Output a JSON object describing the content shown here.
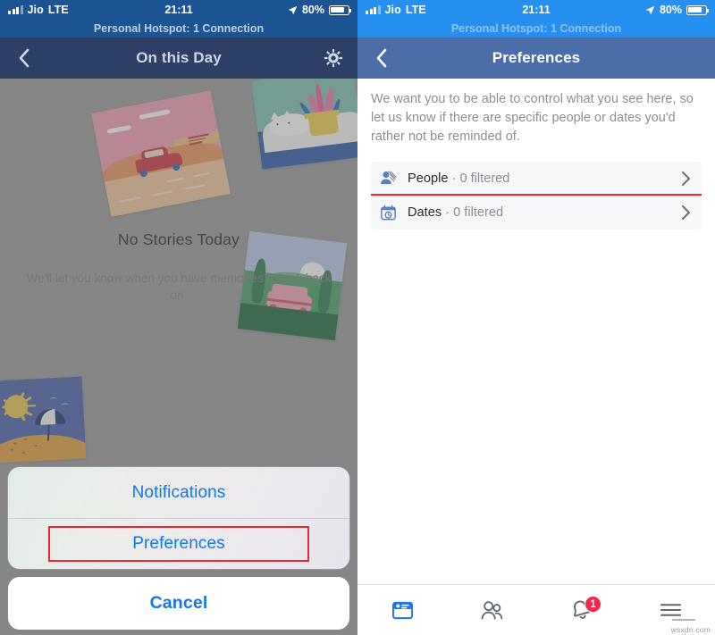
{
  "status_bar": {
    "carrier": "Jio",
    "network": "LTE",
    "time": "21:11",
    "battery_percent": "80%",
    "signal_bars": 3,
    "icons": [
      "signal-bars-icon",
      "location-arrow-icon",
      "battery-icon"
    ]
  },
  "hotspot_banner": {
    "text": "Personal Hotspot: 1 Connection"
  },
  "left_screen": {
    "nav": {
      "back_icon": "chevron-left-icon",
      "title": "On this Day",
      "settings_icon": "gear-icon"
    },
    "empty_state": {
      "title": "No Stories Today",
      "subtitle": "We'll let you know when you have memories to look back on."
    },
    "cards": [
      {
        "name": "memory-card-car",
        "scene": "red car on desert road"
      },
      {
        "name": "memory-card-cat",
        "scene": "white cat beside potted plant"
      },
      {
        "name": "memory-card-van",
        "scene": "pink van among green trees"
      },
      {
        "name": "memory-card-beach",
        "scene": "sun and beach umbrella"
      }
    ],
    "action_sheet": {
      "items": [
        {
          "label": "Notifications",
          "highlighted": false
        },
        {
          "label": "Preferences",
          "highlighted": true
        }
      ],
      "cancel_label": "Cancel"
    }
  },
  "right_screen": {
    "nav": {
      "back_icon": "chevron-left-icon",
      "title": "Preferences"
    },
    "intro_text": "We want you to be able to control what you see here, so let us know if there are specific people or dates you'd rather not be reminded of.",
    "rows": [
      {
        "icon": "people-filter-icon",
        "label": "People",
        "separator": " · ",
        "value": "0 filtered",
        "chevron": "chevron-right-icon",
        "highlighted": false
      },
      {
        "icon": "calendar-clock-icon",
        "label": "Dates",
        "separator": " · ",
        "value": "0 filtered",
        "chevron": "chevron-right-icon",
        "highlighted": true
      }
    ],
    "tab_bar": {
      "tabs": [
        {
          "name": "tab-news-feed",
          "icon": "news-feed-icon",
          "active": true,
          "badge": ""
        },
        {
          "name": "tab-friends",
          "icon": "friends-icon",
          "active": false,
          "badge": ""
        },
        {
          "name": "tab-notifications",
          "icon": "bell-icon",
          "active": false,
          "badge": "1"
        },
        {
          "name": "tab-menu",
          "icon": "hamburger-menu-icon",
          "active": false,
          "badge": ""
        }
      ]
    }
  },
  "watermark": "wsxdn.com",
  "colors": {
    "status_bar_left": "#1c5393",
    "status_bar_right": "#2690f0",
    "nav_left": "#2e3f66",
    "nav_right": "#4a6ea8",
    "accent_blue": "#1375f0",
    "highlight_red": "#e8272e",
    "badge_red": "#f02849",
    "row_bg": "#f6f7f9"
  }
}
